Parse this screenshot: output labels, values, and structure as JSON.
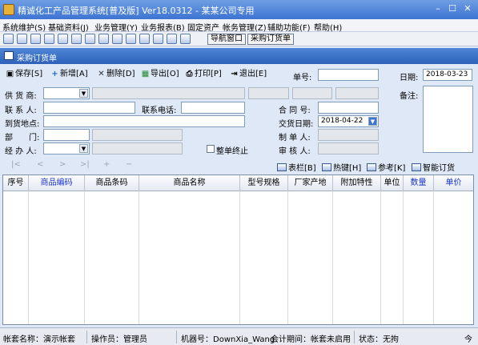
{
  "window": {
    "title": "精诚化工产品管理系统[普及版] Ver18.0312  -  某某公司专用",
    "minimize": "–",
    "maximize": "☐",
    "close": "✕"
  },
  "menu": [
    "系统维护(S)",
    "基础资料(J)",
    "业务管理(Y)",
    "业务报表(B)",
    "固定资产",
    "帐务管理(Z)",
    "辅助功能(F)",
    "帮助(H)"
  ],
  "iconbar": {
    "nav_label": "导航窗口",
    "order_label": "采购订货单"
  },
  "doc_tab": {
    "label": "采购订货单"
  },
  "toolbar": {
    "save": "保存[S]",
    "add": "新增[A]",
    "delete": "删除[D]",
    "export": "导出[O]",
    "print": "打印[P]",
    "exit": "退出[E]",
    "order_no_label": "单号:",
    "order_no": "",
    "date_label": "日期:",
    "date": "2018-03-23"
  },
  "form": {
    "supplier_label": "供 货 商:",
    "contact_label": "联 系 人:",
    "phone_label": "联系电话:",
    "address_label": "到货地点:",
    "dept_label": "部　　门:",
    "handler_label": "经 办 人:",
    "contract_label": "合 同 号:",
    "delivery_label": "交货日期:",
    "delivery_date": "2018-04-22",
    "maker_label": "制 单 人:",
    "auditor_label": "审 核 人:",
    "remark_label": "备注:",
    "end_checkbox_label": "整单终止"
  },
  "actions": {
    "table_bar": "表栏[B]",
    "hotkey": "热键[H]",
    "reference": "参考[K]",
    "smart_order": "智能订货"
  },
  "nav_arrows": [
    "|<",
    "<",
    ">",
    ">|",
    "+",
    "−"
  ],
  "grid": {
    "columns": [
      "序号",
      "商品编码",
      "商品条码",
      "商品名称",
      "型号规格",
      "厂家产地",
      "附加特性",
      "单位",
      "数量",
      "单价"
    ],
    "highlight_columns": [
      "商品编码",
      "数量",
      "单价"
    ]
  },
  "status": {
    "account": "帐套名称：演示帐套",
    "operator": "操作员：管理员",
    "machine": "机器号：DownXia_Wang",
    "period": "会计期间：帐套未启用",
    "state": "状态：无拘",
    "corner": "今"
  },
  "colors": {
    "title_bar": "#3d74d2",
    "doc_tab": "#2d62b8",
    "highlight_text": "#1a35c9"
  }
}
